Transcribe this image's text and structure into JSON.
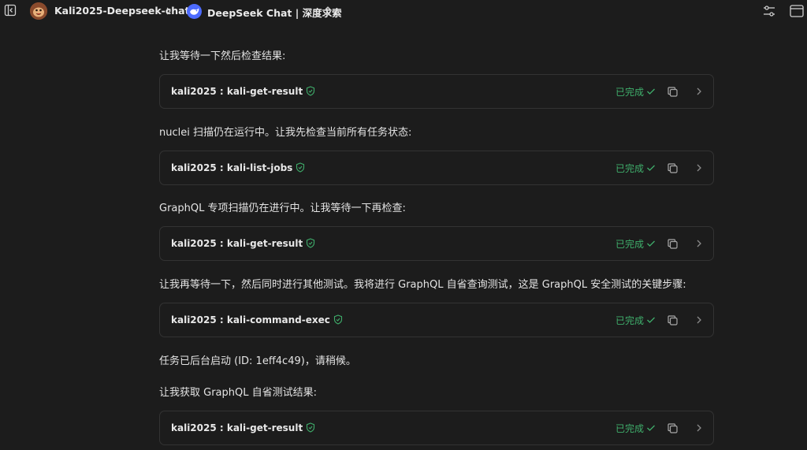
{
  "header": {
    "project_name": "Kali2025-Deepseek-chat",
    "model_name": "DeepSeek Chat | 深度求索"
  },
  "messages": [
    {
      "type": "text",
      "content": "让我等待一下然后检查结果:"
    },
    {
      "type": "tool",
      "label": "kali2025 : kali-get-result",
      "status": "已完成"
    },
    {
      "type": "text",
      "content": "nuclei 扫描仍在运行中。让我先检查当前所有任务状态:"
    },
    {
      "type": "tool",
      "label": "kali2025 : kali-list-jobs",
      "status": "已完成"
    },
    {
      "type": "text",
      "content": "GraphQL 专项扫描仍在进行中。让我等待一下再检查:"
    },
    {
      "type": "tool",
      "label": "kali2025 : kali-get-result",
      "status": "已完成"
    },
    {
      "type": "text",
      "content": "让我再等待一下，然后同时进行其他测试。我将进行 GraphQL 自省查询测试，这是 GraphQL 安全测试的关键步骤:"
    },
    {
      "type": "tool",
      "label": "kali2025 : kali-command-exec",
      "status": "已完成"
    },
    {
      "type": "text",
      "content": "任务已后台启动 (ID: 1eff4c49)，请稍候。"
    },
    {
      "type": "text",
      "content": "让我获取 GraphQL 自省测试结果:"
    },
    {
      "type": "tool",
      "label": "kali2025 : kali-get-result",
      "status": "已完成"
    }
  ],
  "colors": {
    "background": "#1c1c1c",
    "card_border": "#333333",
    "status_green": "#3fae6b",
    "model_logo_blue": "#4d6bfe"
  }
}
